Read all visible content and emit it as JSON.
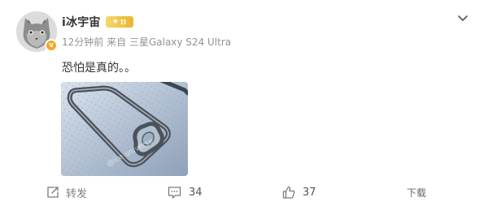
{
  "post": {
    "username": "i冰宇宙",
    "level_badge": "II",
    "time": "12分钟前",
    "source_prefix": "来自",
    "source_device": "三星Galaxy S24 Ultra",
    "text": "恐怕是真的。。",
    "image_watermark": "@ice universe"
  },
  "actions": {
    "repost_label": "转发",
    "comment_count": "34",
    "like_count": "37",
    "download_label": "下载"
  },
  "colors": {
    "text_primary": "#333333",
    "text_meta": "#939393",
    "badge_gold": "#e9b62f",
    "verified_orange": "#f5a623",
    "action_gray": "#808080"
  },
  "icons": [
    "cat-avatar",
    "verified-v-icon",
    "level-star-icon",
    "chevron-down-icon",
    "repost-icon",
    "comment-icon",
    "like-icon"
  ]
}
